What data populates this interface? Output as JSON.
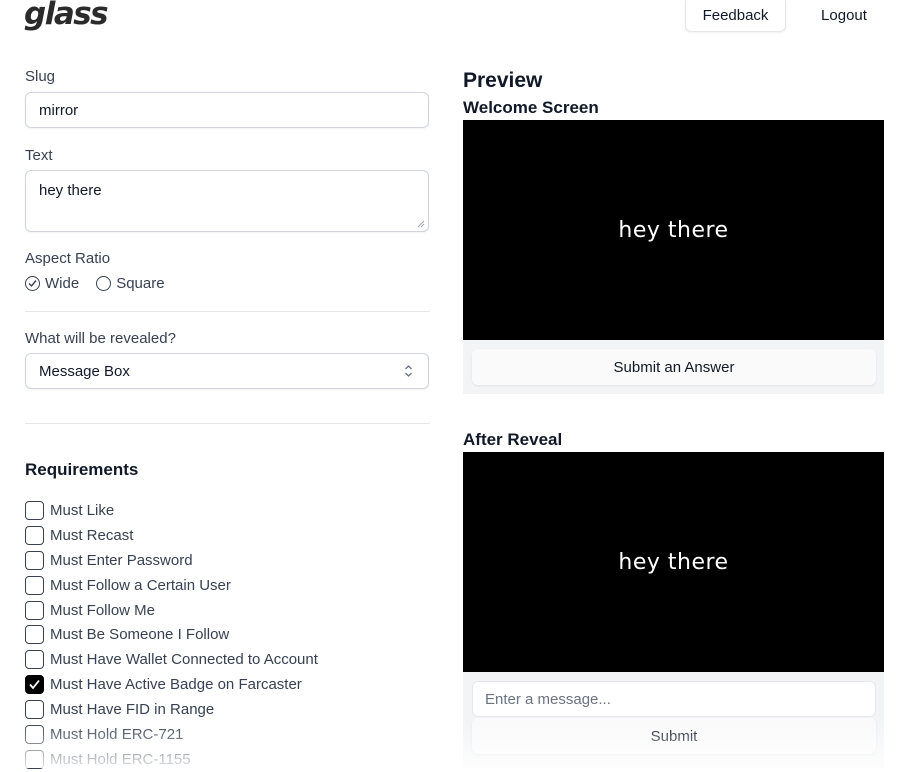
{
  "header": {
    "logo": "glass",
    "feedback_label": "Feedback",
    "logout_label": "Logout"
  },
  "form": {
    "slug": {
      "label": "Slug",
      "value": "mirror"
    },
    "text": {
      "label": "Text",
      "value": "hey there"
    },
    "aspect_ratio": {
      "label": "Aspect Ratio",
      "options": [
        "Wide",
        "Square"
      ],
      "selected": "Wide"
    },
    "reveal": {
      "label": "What will be revealed?",
      "selected": "Message Box"
    }
  },
  "requirements": {
    "title": "Requirements",
    "items": [
      {
        "label": "Must Like",
        "checked": false
      },
      {
        "label": "Must Recast",
        "checked": false
      },
      {
        "label": "Must Enter Password",
        "checked": false
      },
      {
        "label": "Must Follow a Certain User",
        "checked": false
      },
      {
        "label": "Must Follow Me",
        "checked": false
      },
      {
        "label": "Must Be Someone I Follow",
        "checked": false
      },
      {
        "label": "Must Have Wallet Connected to Account",
        "checked": false
      },
      {
        "label": "Must Have Active Badge on Farcaster",
        "checked": true
      },
      {
        "label": "Must Have FID in Range",
        "checked": false
      },
      {
        "label": "Must Hold ERC-721",
        "checked": false
      },
      {
        "label": "Must Hold ERC-1155",
        "checked": false
      }
    ]
  },
  "preview": {
    "title": "Preview",
    "welcome": {
      "title": "Welcome Screen",
      "frame_text": "hey there",
      "button_label": "Submit an Answer"
    },
    "after": {
      "title": "After Reveal",
      "frame_text": "hey there",
      "input_placeholder": "Enter a message...",
      "button_label": "Submit"
    }
  },
  "colors": {
    "frame_bg": "#000000",
    "frame_text": "#ffffff",
    "checked_box": "#000000",
    "footer_bg": "#f3f4f6"
  }
}
